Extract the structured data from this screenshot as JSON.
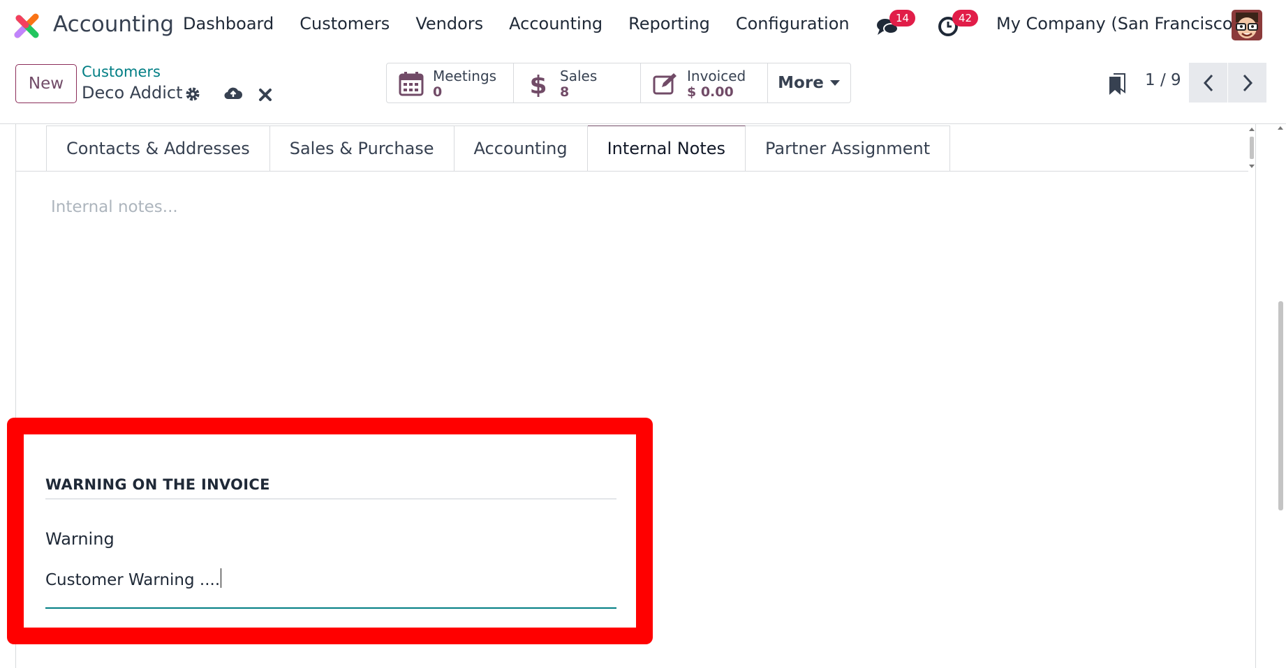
{
  "navbar": {
    "app_name": "Accounting",
    "menu": [
      "Dashboard",
      "Customers",
      "Vendors",
      "Accounting",
      "Reporting",
      "Configuration"
    ],
    "messages_count": "14",
    "activities_count": "42",
    "company": "My Company (San Francisco)"
  },
  "control": {
    "new_label": "New",
    "breadcrumb_parent": "Customers",
    "breadcrumb_current": "Deco Addict",
    "smart_buttons": [
      {
        "label": "Meetings",
        "value": "0",
        "icon": "calendar-icon"
      },
      {
        "label": "Sales",
        "value": "8",
        "icon": "dollar-icon"
      },
      {
        "label": "Invoiced",
        "value": "$ 0.00",
        "icon": "edit-icon"
      }
    ],
    "more_label": "More",
    "pager": "1 / 9"
  },
  "tabs": [
    "Contacts & Addresses",
    "Sales & Purchase",
    "Accounting",
    "Internal Notes",
    "Partner Assignment"
  ],
  "active_tab": "Internal Notes",
  "notes_placeholder": "Internal notes...",
  "warning": {
    "title": "WARNING ON THE INVOICE",
    "field_label": "Warning",
    "message": "Customer Warning ...."
  },
  "colors": {
    "brand": "#714b67",
    "link": "#017e84",
    "badge": "#e11d48",
    "highlight": "#ff0000"
  }
}
